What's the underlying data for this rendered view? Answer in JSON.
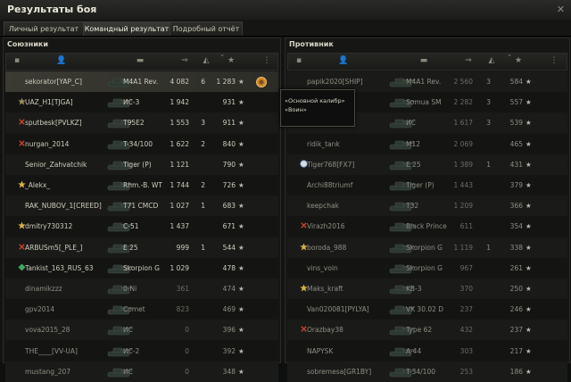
{
  "window": {
    "title": "Результаты боя"
  },
  "tabs": [
    {
      "label": "Личный результат",
      "active": false
    },
    {
      "label": "Командный результат",
      "active": true
    },
    {
      "label": "Подробный отчёт",
      "active": false
    }
  ],
  "allies": {
    "title": "Союзники",
    "rows": [
      {
        "name": "sekorator[YAP_C]",
        "tank": "M4A1 Rev.",
        "damage": "4 082",
        "kills": "6",
        "xp": "1 283",
        "self": true,
        "alive": true,
        "badge": ""
      },
      {
        "name": "UAZ_H1[TJGA]",
        "tank": "ИС-3",
        "damage": "1 942",
        "kills": "",
        "xp": "931",
        "self": false,
        "alive": true,
        "badge": "medal"
      },
      {
        "name": "sputbesk[PVLKZ]",
        "tank": "T95E2",
        "damage": "1 553",
        "kills": "3",
        "xp": "911",
        "self": false,
        "alive": true,
        "badge": "cross"
      },
      {
        "name": "nurgan_2014",
        "tank": "T-34/100",
        "damage": "1 622",
        "kills": "2",
        "xp": "840",
        "self": false,
        "alive": true,
        "badge": "cross"
      },
      {
        "name": "Senior_Zahvatchik",
        "tank": "Tiger (P)",
        "damage": "1 121",
        "kills": "",
        "xp": "790",
        "self": false,
        "alive": true,
        "badge": ""
      },
      {
        "name": "_Alekx_",
        "tank": "Rhm.-B. WT",
        "damage": "1 744",
        "kills": "2",
        "xp": "726",
        "self": false,
        "alive": true,
        "badge": "star"
      },
      {
        "name": "RAK_NUBOV_1[CREED]",
        "tank": "T71 CMCD",
        "damage": "1 027",
        "kills": "1",
        "xp": "683",
        "self": false,
        "alive": true,
        "badge": ""
      },
      {
        "name": "dmitry730312",
        "tank": "C-51",
        "damage": "1 437",
        "kills": "",
        "xp": "671",
        "self": false,
        "alive": true,
        "badge": "star"
      },
      {
        "name": "ARBUSm5[_PLE_]",
        "tank": "E 25",
        "damage": "999",
        "kills": "1",
        "xp": "544",
        "self": false,
        "alive": true,
        "badge": "cross"
      },
      {
        "name": "Tankist_163_RUS_63",
        "tank": "Skorpion G",
        "damage": "1 029",
        "kills": "",
        "xp": "478",
        "self": false,
        "alive": true,
        "badge": "diamond"
      },
      {
        "name": "dinamikzzz",
        "tank": "0-Ni",
        "damage": "361",
        "kills": "",
        "xp": "474",
        "self": false,
        "alive": false,
        "badge": ""
      },
      {
        "name": "gpv2014",
        "tank": "Comet",
        "damage": "823",
        "kills": "",
        "xp": "469",
        "self": false,
        "alive": false,
        "badge": ""
      },
      {
        "name": "vova2015_28",
        "tank": "ИС",
        "damage": "0",
        "kills": "",
        "xp": "396",
        "self": false,
        "alive": false,
        "badge": ""
      },
      {
        "name": "THE____[VV-UA]",
        "tank": "ИС-2",
        "damage": "0",
        "kills": "",
        "xp": "392",
        "self": false,
        "alive": false,
        "badge": ""
      },
      {
        "name": "mustang_207",
        "tank": "ИС",
        "damage": "0",
        "kills": "",
        "xp": "348",
        "self": false,
        "alive": false,
        "badge": ""
      }
    ]
  },
  "enemies": {
    "title": "Противник",
    "rows": [
      {
        "name": "papik2020[SHIP]",
        "tank": "M4A1 Rev.",
        "damage": "2 560",
        "kills": "3",
        "xp": "584",
        "alive": false,
        "badge": ""
      },
      {
        "name": "",
        "tank": "Somua SM",
        "damage": "2 282",
        "kills": "3",
        "xp": "557",
        "alive": false,
        "badge": ""
      },
      {
        "name": "",
        "tank": "ИС",
        "damage": "1 617",
        "kills": "3",
        "xp": "539",
        "alive": false,
        "badge": ""
      },
      {
        "name": "ridik_tank",
        "tank": "M12",
        "damage": "2 069",
        "kills": "",
        "xp": "465",
        "alive": false,
        "badge": ""
      },
      {
        "name": "Tiger768[FX7]",
        "tank": "E 25",
        "damage": "1 389",
        "kills": "1",
        "xp": "431",
        "alive": false,
        "badge": "shield"
      },
      {
        "name": "Archi88triumf",
        "tank": "Tiger (P)",
        "damage": "1 443",
        "kills": "",
        "xp": "379",
        "alive": false,
        "badge": ""
      },
      {
        "name": "keepchak",
        "tank": "T32",
        "damage": "1 209",
        "kills": "",
        "xp": "366",
        "alive": false,
        "badge": ""
      },
      {
        "name": "Virazh2016",
        "tank": "Black Prince",
        "damage": "611",
        "kills": "",
        "xp": "354",
        "alive": false,
        "badge": "cross"
      },
      {
        "name": "boroda_988",
        "tank": "Skorpion G",
        "damage": "1 119",
        "kills": "1",
        "xp": "338",
        "alive": false,
        "badge": "star"
      },
      {
        "name": "vins_voin",
        "tank": "Skorpion G",
        "damage": "967",
        "kills": "",
        "xp": "261",
        "alive": false,
        "badge": ""
      },
      {
        "name": "Maks_kraft",
        "tank": "KB-3",
        "damage": "370",
        "kills": "",
        "xp": "250",
        "alive": false,
        "badge": "star"
      },
      {
        "name": "Van020081[PYLYA]",
        "tank": "VK 30.02 D",
        "damage": "237",
        "kills": "",
        "xp": "246",
        "alive": false,
        "badge": ""
      },
      {
        "name": "Orazbay38",
        "tank": "Type 62",
        "damage": "432",
        "kills": "",
        "xp": "237",
        "alive": false,
        "badge": "cross"
      },
      {
        "name": "NAPYSK",
        "tank": "A-44",
        "damage": "303",
        "kills": "",
        "xp": "217",
        "alive": false,
        "badge": ""
      },
      {
        "name": "sobremesa[GR1BY]",
        "tank": "T-34/100",
        "damage": "253",
        "kills": "",
        "xp": "186",
        "alive": false,
        "badge": ""
      }
    ]
  },
  "tooltip": {
    "line1": "«Основной калибр»",
    "line2": "«Воин»"
  },
  "icons": {
    "player": "player-icon",
    "tank": "tank-icon",
    "damage": "damage-icon",
    "kills": "kills-icon",
    "xp": "star-icon",
    "sort": "sort-arrow-icon",
    "menu": "menu-icon",
    "platoon": "platoon-icon"
  },
  "colors": {
    "accent": "#e8a53a",
    "alive_text": "#cfccbd",
    "dead_text": "#8f8d83"
  }
}
